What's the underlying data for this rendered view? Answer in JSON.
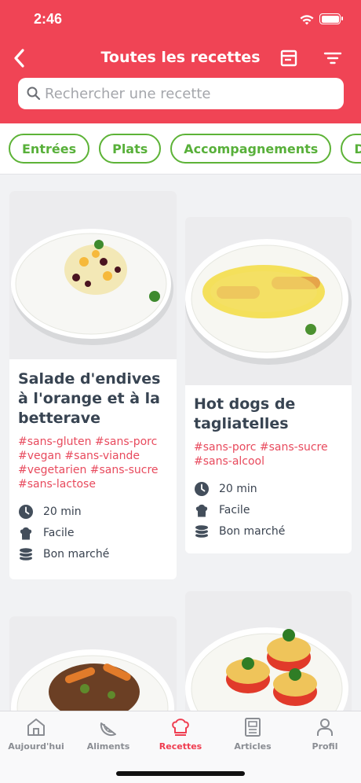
{
  "status": {
    "time": "2:46"
  },
  "header": {
    "title": "Toutes les recettes",
    "bg": "#f04455"
  },
  "search": {
    "placeholder": "Rechercher une recette"
  },
  "categories": [
    "Entrées",
    "Plats",
    "Accompagnements",
    "Desserts"
  ],
  "recipes": [
    {
      "title": "Salade d'endives à l'orange et à la betterave",
      "tags": "#sans-gluten #sans-porc #vegan #sans-viande #vegetarien #sans-sucre #sans-lactose",
      "time": "20 min",
      "difficulty": "Facile",
      "cost": "Bon marché"
    },
    {
      "title": "Hot dogs de tagliatelles",
      "tags": "#sans-porc #sans-sucre #sans-alcool",
      "time": "20 min",
      "difficulty": "Facile",
      "cost": "Bon marché"
    }
  ],
  "tabs": [
    {
      "label": "Aujourd'hui",
      "icon": "home-icon"
    },
    {
      "label": "Aliments",
      "icon": "watermelon-icon"
    },
    {
      "label": "Recettes",
      "icon": "chef-hat-icon",
      "active": true
    },
    {
      "label": "Articles",
      "icon": "article-icon"
    },
    {
      "label": "Profil",
      "icon": "profile-icon"
    }
  ],
  "colors": {
    "accent": "#f04455",
    "chip": "#5db337",
    "tag": "#e84a5d"
  }
}
